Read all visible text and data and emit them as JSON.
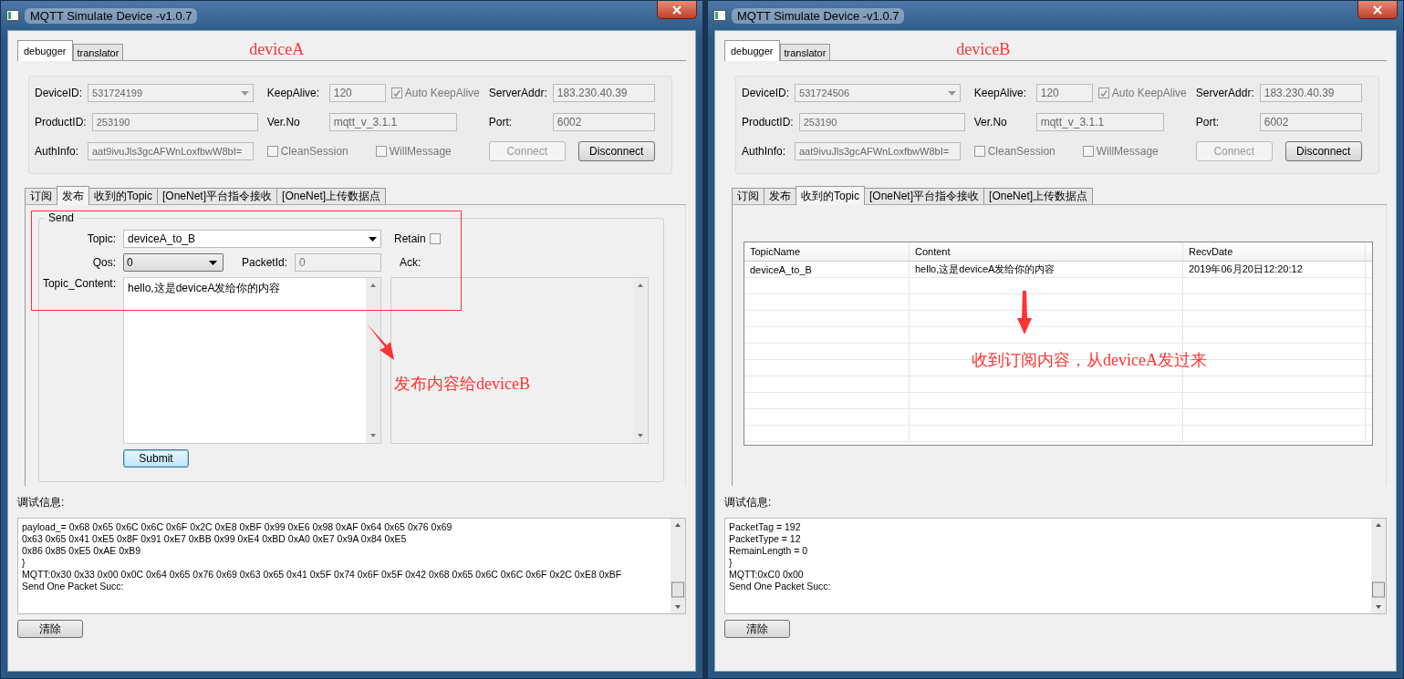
{
  "windows": [
    {
      "title": "MQTT Simulate Device  -v1.0.7",
      "annotation": "deviceA",
      "top_tabs": [
        {
          "label": "debugger",
          "selected": true
        },
        {
          "label": "translator",
          "selected": false
        }
      ],
      "connection": {
        "locked": true,
        "device_id": {
          "label": "DeviceID:",
          "value": "531724199"
        },
        "product_id": {
          "label": "ProductID:",
          "value": "253190"
        },
        "auth_info": {
          "label": "AuthInfo:",
          "value": "aat9ivuJls3gcAFWnLoxfbwW8bI="
        },
        "keep_alive": {
          "label": "KeepAlive:",
          "value": "120"
        },
        "auto_keepalive": {
          "label": "Auto KeepAlive",
          "checked": true
        },
        "ver_no": {
          "label": "Ver.No",
          "value": "mqtt_v_3.1.1"
        },
        "clean_session": {
          "label": "CleanSession",
          "checked": false
        },
        "will_message": {
          "label": "WillMessage",
          "checked": false
        },
        "server_addr": {
          "label": "ServerAddr:",
          "value": "183.230.40.39"
        },
        "port": {
          "label": "Port:",
          "value": "6002"
        },
        "buttons": [
          {
            "label": "Connect",
            "disabled": true
          },
          {
            "label": "Disconnect",
            "disabled": false
          }
        ]
      },
      "tabs": [
        {
          "label": "订阅",
          "selected": false
        },
        {
          "label": "发布",
          "selected": true
        },
        {
          "label": "收到的Topic",
          "selected": false
        },
        {
          "label": "[OneNet]平台指令接收",
          "selected": false
        },
        {
          "label": "[OneNet]上传数据点",
          "selected": false
        }
      ],
      "panel": {
        "kind": "publish",
        "group": "Send",
        "topic": {
          "label": "Topic:",
          "value": "deviceA_to_B"
        },
        "retain": {
          "label": "Retain",
          "checked": false
        },
        "qos": {
          "label": "Qos:",
          "value": "0"
        },
        "packet_id": {
          "label": "PacketId:",
          "value": "0",
          "disabled": true
        },
        "ack": {
          "label": "Ack:"
        },
        "content": {
          "label": "Topic_Content:",
          "value": "hello,这是deviceA发给你的内容"
        },
        "submit": "Submit",
        "note": "发布内容给deviceB"
      },
      "log": {
        "label": "调试信息:",
        "lines": [
          "payload_= 0x68 0x65 0x6C 0x6C 0x6F 0x2C 0xE8 0xBF 0x99 0xE6 0x98 0xAF 0x64 0x65 0x76 0x69",
          "0x63 0x65 0x41 0xE5 0x8F 0x91 0xE7 0xBB 0x99 0xE4 0xBD 0xA0 0xE7 0x9A 0x84 0xE5",
          "0x86 0x85 0xE5 0xAE 0xB9",
          "}",
          "MQTT:0x30 0x33 0x00 0x0C 0x64 0x65 0x76 0x69 0x63 0x65 0x41 0x5F 0x74 0x6F 0x5F 0x42 0x68 0x65 0x6C 0x6C 0x6F 0x2C 0xE8 0xBF",
          "Send One Packet Succ:"
        ]
      },
      "clear_button": "清除"
    },
    {
      "title": "MQTT Simulate Device  -v1.0.7",
      "annotation": "deviceB",
      "top_tabs": [
        {
          "label": "debugger",
          "selected": true
        },
        {
          "label": "translator",
          "selected": false
        }
      ],
      "connection": {
        "locked": true,
        "device_id": {
          "label": "DeviceID:",
          "value": "531724506"
        },
        "product_id": {
          "label": "ProductID:",
          "value": "253190"
        },
        "auth_info": {
          "label": "AuthInfo:",
          "value": "aat9ivuJls3gcAFWnLoxfbwW8bI="
        },
        "keep_alive": {
          "label": "KeepAlive:",
          "value": "120"
        },
        "auto_keepalive": {
          "label": "Auto KeepAlive",
          "checked": true
        },
        "ver_no": {
          "label": "Ver.No",
          "value": "mqtt_v_3.1.1"
        },
        "clean_session": {
          "label": "CleanSession",
          "checked": false
        },
        "will_message": {
          "label": "WillMessage",
          "checked": false
        },
        "server_addr": {
          "label": "ServerAddr:",
          "value": "183.230.40.39"
        },
        "port": {
          "label": "Port:",
          "value": "6002"
        },
        "buttons": [
          {
            "label": "Connect",
            "disabled": true
          },
          {
            "label": "Disconnect",
            "disabled": false
          }
        ]
      },
      "tabs": [
        {
          "label": "订阅",
          "selected": false
        },
        {
          "label": "发布",
          "selected": false
        },
        {
          "label": "收到的Topic",
          "selected": true
        },
        {
          "label": "[OneNet]平台指令接收",
          "selected": false
        },
        {
          "label": "[OneNet]上传数据点",
          "selected": false
        }
      ],
      "panel": {
        "kind": "received",
        "columns": [
          "TopicName",
          "Content",
          "RecvDate"
        ],
        "rows": [
          [
            "deviceA_to_B",
            "hello,这是deviceA发给你的内容",
            "2019年06月20日12:20:12"
          ]
        ],
        "note": "收到订阅内容，从deviceA发过来"
      },
      "log": {
        "label": "调试信息:",
        "lines": [
          "PacketTag = 192",
          "PacketType  = 12",
          "RemainLength  = 0",
          "}",
          "MQTT:0xC0 0x00",
          "Send One Packet Succ:"
        ]
      },
      "clear_button": "清除"
    }
  ]
}
